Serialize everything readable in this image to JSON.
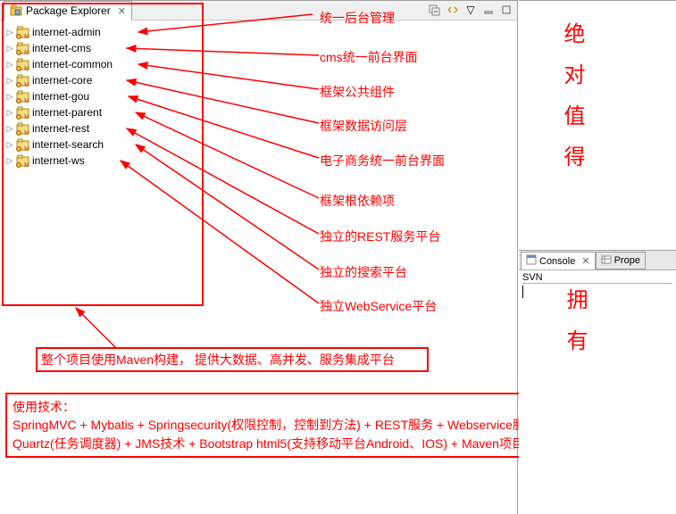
{
  "explorer": {
    "title": "Package Explorer",
    "projects": [
      {
        "name": "internet-admin"
      },
      {
        "name": "internet-cms"
      },
      {
        "name": "internet-common"
      },
      {
        "name": "internet-core"
      },
      {
        "name": "internet-gou"
      },
      {
        "name": "internet-parent"
      },
      {
        "name": "internet-rest"
      },
      {
        "name": "internet-search"
      },
      {
        "name": "internet-ws"
      }
    ]
  },
  "annotations": {
    "top": "统一后台管理",
    "list": [
      "cms统一前台界面",
      "框架公共组件",
      "框架数据访问层",
      "电子商务统一前台界面",
      "框架根依赖项",
      "独立的REST服务平台",
      "独立的搜索平台",
      "独立WebService平台"
    ],
    "summary1": "整个项目使用Maven构建， 提供大数据、高并发、服务集成平台",
    "summary2": "使用技术：\nSpringMVC + Mybatis + Springsecurity(权限控制，控制到方法) + REST服务 + Webservice服务 +  Lucene搜索 + Quartz(任务调度器) + JMS技术 + Bootstrap html5(支持移动平台Android、IOS) + Maven项目构建"
  },
  "slogan": {
    "part1": "绝对值得",
    "part2": "拥有"
  },
  "console": {
    "tab1": "Console",
    "tab2": "Prope",
    "title": "SVN"
  }
}
